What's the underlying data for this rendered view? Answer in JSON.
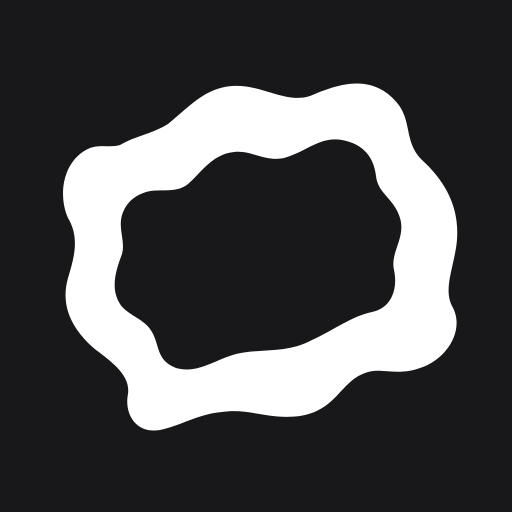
{
  "icon": {
    "name": "blob-ring-logo-icon",
    "background_color": "#18181a",
    "shape_color": "#ffffff"
  }
}
